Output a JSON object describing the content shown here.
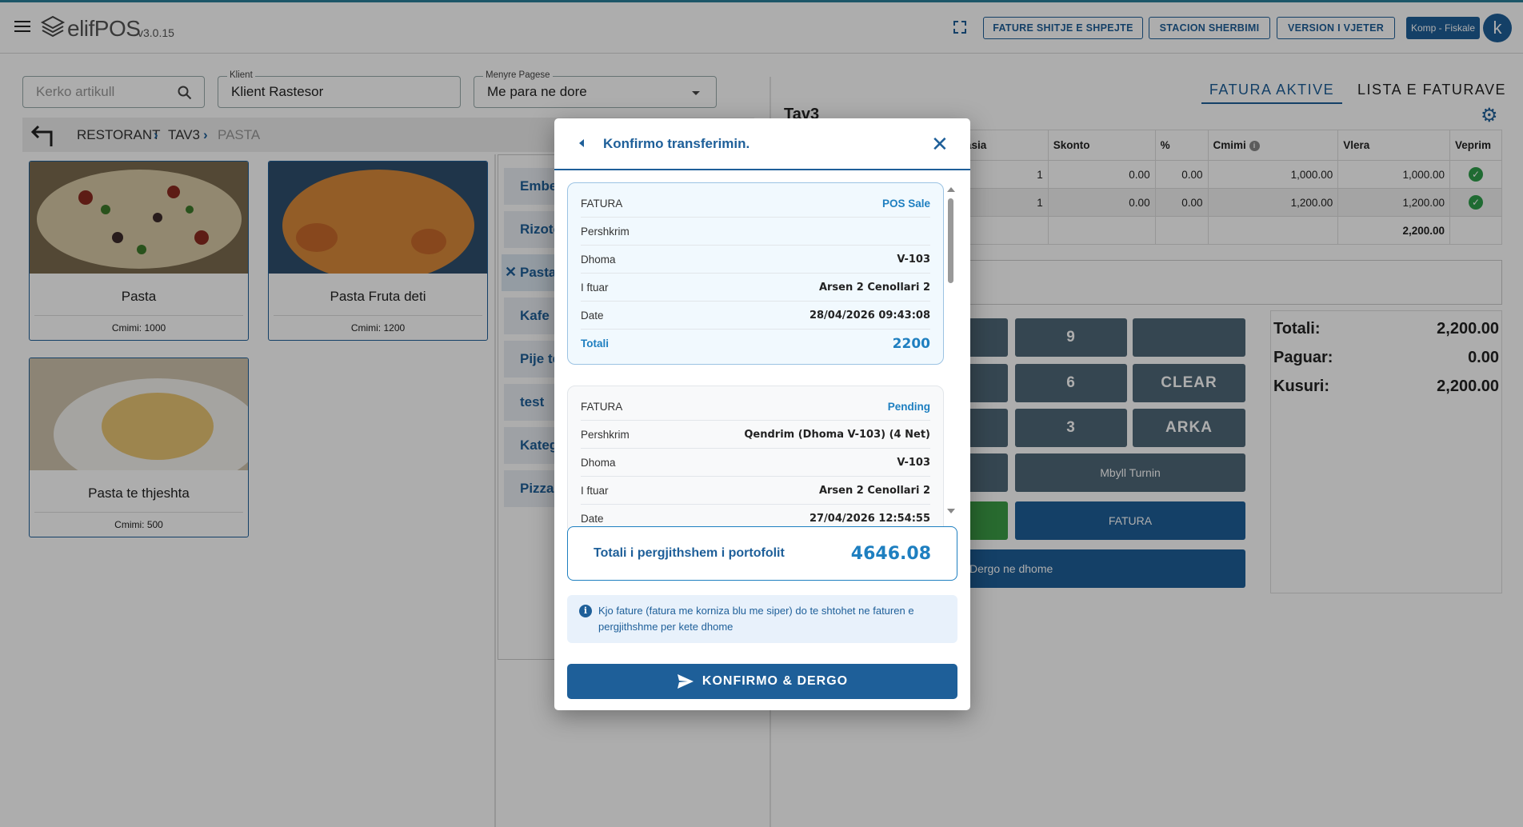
{
  "app": {
    "name": "elifPOS",
    "version": "v3.0.15"
  },
  "topbar": {
    "buttons": [
      "FATURE SHITJE E SHPEJTE",
      "STACION SHERBIMI",
      "VERSION I VJETER"
    ],
    "company": "Komp - Fiskale",
    "avatar": "k"
  },
  "filters": {
    "search_placeholder": "Kerko artikull",
    "client_label": "Klient",
    "client_value": "Klient Rastesor",
    "payment_label": "Menyre Pagese",
    "payment_value": "Me para ne dore"
  },
  "breadcrumb": [
    "RESTORANT",
    "TAV3",
    "PASTA"
  ],
  "products": [
    {
      "name": "Pasta",
      "price": "Cmimi: 1000"
    },
    {
      "name": "Pasta Fruta deti",
      "price": "Cmimi: 1200"
    },
    {
      "name": "Pasta te thjeshta",
      "price": "Cmimi: 500"
    }
  ],
  "categories": [
    "Embel",
    "Rizoto",
    "Pasta",
    "Kafe",
    "Pije te",
    "test",
    "Kateg",
    "Pizza"
  ],
  "right": {
    "tab_active": "FATURA AKTIVE",
    "tab_list": "LISTA E FATURAVE",
    "table_title": "Tav3",
    "columns": [
      "asia",
      "Skonto",
      "%",
      "Cmimi",
      "Vlera",
      "Veprim"
    ],
    "rows": [
      [
        "1",
        "0.00",
        "0.00",
        "1,000.00",
        "1,000.00"
      ],
      [
        "1",
        "0.00",
        "0.00",
        "1,200.00",
        "1,200.00"
      ]
    ],
    "total_row": "2,200.00"
  },
  "keypad": {
    "k9": "9",
    "k6": "6",
    "clear": "CLEAR",
    "k3": "3",
    "arka": "ARKA",
    "mbyll": "Mbyll Turnin",
    "fatura": "FATURA",
    "dergo": "Dergo ne dhome"
  },
  "totals": {
    "totali_label": "Totali:",
    "totali": "2,200.00",
    "paguar_label": "Paguar:",
    "paguar": "0.00",
    "kusuri_label": "Kusuri:",
    "kusuri": "2,200.00"
  },
  "modal": {
    "title": "Konfirmo transferimin.",
    "invoices": [
      {
        "header": "FATURA",
        "status": "POS Sale",
        "rows": [
          {
            "k": "Pershkrim",
            "v": ""
          },
          {
            "k": "Dhoma",
            "v": "V-103"
          },
          {
            "k": "I ftuar",
            "v": "Arsen 2 Cenollari 2"
          },
          {
            "k": "Date",
            "v": "28/04/2026 09:43:08"
          },
          {
            "k": "Totali",
            "v": "2200"
          }
        ]
      },
      {
        "header": "FATURA",
        "status": "Pending",
        "rows": [
          {
            "k": "Pershkrim",
            "v": "Qendrim (Dhoma V-103) (4 Net)"
          },
          {
            "k": "Dhoma",
            "v": "V-103"
          },
          {
            "k": "I ftuar",
            "v": "Arsen 2 Cenollari 2"
          },
          {
            "k": "Date",
            "v": "27/04/2026 12:54:55"
          }
        ]
      }
    ],
    "portfolio_label": "Totali i pergjithshem i portofolit",
    "portfolio_value": "4646.08",
    "info": "Kjo fature (fatura me korniza blu me siper) do te shtohet ne faturen e pergjithshme per kete dhome",
    "confirm": "KONFIRMO & DERGO"
  },
  "colors": {
    "primary": "#1e5f99",
    "accent_blue": "#1e7fc0",
    "keypad": "#4f6778",
    "success": "#2e9e4a"
  }
}
